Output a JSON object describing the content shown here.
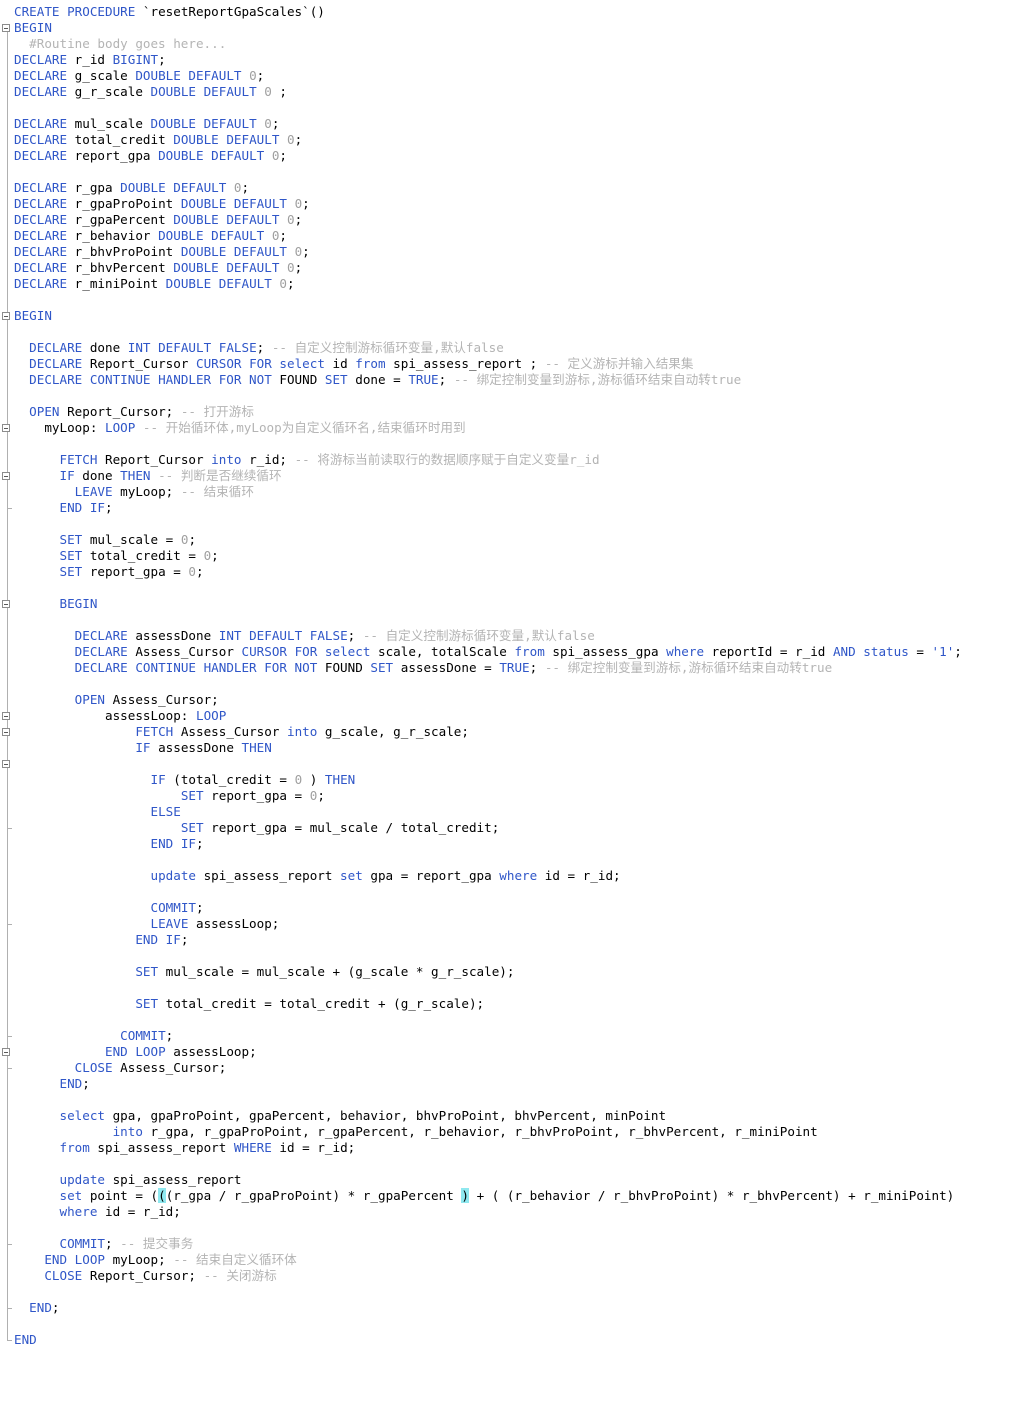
{
  "editor": {
    "lines": [
      [
        [
          "k",
          "CREATE PROCEDURE "
        ],
        [
          "t",
          "`resetReportGpaScales`()"
        ]
      ],
      [
        [
          "k",
          "BEGIN"
        ]
      ],
      [
        [
          "c",
          "  #Routine body goes here..."
        ]
      ],
      [
        [
          "k",
          "DECLARE "
        ],
        [
          "t",
          "r_id "
        ],
        [
          "k",
          "BIGINT"
        ],
        [
          "t",
          ";"
        ]
      ],
      [
        [
          "k",
          "DECLARE "
        ],
        [
          "t",
          "g_scale "
        ],
        [
          "k",
          "DOUBLE DEFAULT "
        ],
        [
          "n",
          "0"
        ],
        [
          "t",
          ";"
        ]
      ],
      [
        [
          "k",
          "DECLARE "
        ],
        [
          "t",
          "g_r_scale "
        ],
        [
          "k",
          "DOUBLE DEFAULT "
        ],
        [
          "n",
          "0"
        ],
        [
          "t",
          " ;"
        ]
      ],
      [],
      [
        [
          "k",
          "DECLARE "
        ],
        [
          "t",
          "mul_scale "
        ],
        [
          "k",
          "DOUBLE DEFAULT "
        ],
        [
          "n",
          "0"
        ],
        [
          "t",
          ";"
        ]
      ],
      [
        [
          "k",
          "DECLARE "
        ],
        [
          "t",
          "total_credit "
        ],
        [
          "k",
          "DOUBLE DEFAULT "
        ],
        [
          "n",
          "0"
        ],
        [
          "t",
          ";"
        ]
      ],
      [
        [
          "k",
          "DECLARE "
        ],
        [
          "t",
          "report_gpa "
        ],
        [
          "k",
          "DOUBLE DEFAULT "
        ],
        [
          "n",
          "0"
        ],
        [
          "t",
          ";"
        ]
      ],
      [],
      [
        [
          "k",
          "DECLARE "
        ],
        [
          "t",
          "r_gpa "
        ],
        [
          "k",
          "DOUBLE DEFAULT "
        ],
        [
          "n",
          "0"
        ],
        [
          "t",
          ";"
        ]
      ],
      [
        [
          "k",
          "DECLARE "
        ],
        [
          "t",
          "r_gpaProPoint "
        ],
        [
          "k",
          "DOUBLE DEFAULT "
        ],
        [
          "n",
          "0"
        ],
        [
          "t",
          ";"
        ]
      ],
      [
        [
          "k",
          "DECLARE "
        ],
        [
          "t",
          "r_gpaPercent "
        ],
        [
          "k",
          "DOUBLE DEFAULT "
        ],
        [
          "n",
          "0"
        ],
        [
          "t",
          ";"
        ]
      ],
      [
        [
          "k",
          "DECLARE "
        ],
        [
          "t",
          "r_behavior "
        ],
        [
          "k",
          "DOUBLE DEFAULT "
        ],
        [
          "n",
          "0"
        ],
        [
          "t",
          ";"
        ]
      ],
      [
        [
          "k",
          "DECLARE "
        ],
        [
          "t",
          "r_bhvProPoint "
        ],
        [
          "k",
          "DOUBLE DEFAULT "
        ],
        [
          "n",
          "0"
        ],
        [
          "t",
          ";"
        ]
      ],
      [
        [
          "k",
          "DECLARE "
        ],
        [
          "t",
          "r_bhvPercent "
        ],
        [
          "k",
          "DOUBLE DEFAULT "
        ],
        [
          "n",
          "0"
        ],
        [
          "t",
          ";"
        ]
      ],
      [
        [
          "k",
          "DECLARE "
        ],
        [
          "t",
          "r_miniPoint "
        ],
        [
          "k",
          "DOUBLE DEFAULT "
        ],
        [
          "n",
          "0"
        ],
        [
          "t",
          ";"
        ]
      ],
      [],
      [
        [
          "k",
          "BEGIN"
        ]
      ],
      [],
      [
        [
          "t",
          "  "
        ],
        [
          "k",
          "DECLARE "
        ],
        [
          "t",
          "done "
        ],
        [
          "k",
          "INT DEFAULT FALSE"
        ],
        [
          "t",
          "; "
        ],
        [
          "c",
          "-- 自定义控制游标循环变量,默认false"
        ]
      ],
      [
        [
          "t",
          "  "
        ],
        [
          "k",
          "DECLARE "
        ],
        [
          "t",
          "Report_Cursor "
        ],
        [
          "k",
          "CURSOR FOR select "
        ],
        [
          "t",
          "id "
        ],
        [
          "k",
          "from "
        ],
        [
          "t",
          "spi_assess_report ; "
        ],
        [
          "c",
          "-- 定义游标并输入结果集"
        ]
      ],
      [
        [
          "t",
          "  "
        ],
        [
          "k",
          "DECLARE CONTINUE HANDLER FOR NOT "
        ],
        [
          "t",
          "FOUND "
        ],
        [
          "k",
          "SET "
        ],
        [
          "t",
          "done = "
        ],
        [
          "k",
          "TRUE"
        ],
        [
          "t",
          "; "
        ],
        [
          "c",
          "-- 绑定控制变量到游标,游标循环结束自动转true"
        ]
      ],
      [],
      [
        [
          "t",
          "  "
        ],
        [
          "k",
          "OPEN "
        ],
        [
          "t",
          "Report_Cursor; "
        ],
        [
          "c",
          "-- 打开游标"
        ]
      ],
      [
        [
          "t",
          "    myLoop: "
        ],
        [
          "k",
          "LOOP "
        ],
        [
          "c",
          "-- 开始循环体,myLoop为自定义循环名,结束循环时用到"
        ]
      ],
      [],
      [
        [
          "t",
          "      "
        ],
        [
          "k",
          "FETCH "
        ],
        [
          "t",
          "Report_Cursor "
        ],
        [
          "k",
          "into "
        ],
        [
          "t",
          "r_id; "
        ],
        [
          "c",
          "-- 将游标当前读取行的数据顺序赋于自定义变量r_id"
        ]
      ],
      [
        [
          "t",
          "      "
        ],
        [
          "k",
          "IF "
        ],
        [
          "t",
          "done "
        ],
        [
          "k",
          "THEN "
        ],
        [
          "c",
          "-- 判断是否继续循环"
        ]
      ],
      [
        [
          "t",
          "        "
        ],
        [
          "k",
          "LEAVE "
        ],
        [
          "t",
          "myLoop; "
        ],
        [
          "c",
          "-- 结束循环"
        ]
      ],
      [
        [
          "t",
          "      "
        ],
        [
          "k",
          "END IF"
        ],
        [
          "t",
          ";"
        ]
      ],
      [],
      [
        [
          "t",
          "      "
        ],
        [
          "k",
          "SET "
        ],
        [
          "t",
          "mul_scale = "
        ],
        [
          "n",
          "0"
        ],
        [
          "t",
          ";"
        ]
      ],
      [
        [
          "t",
          "      "
        ],
        [
          "k",
          "SET "
        ],
        [
          "t",
          "total_credit = "
        ],
        [
          "n",
          "0"
        ],
        [
          "t",
          ";"
        ]
      ],
      [
        [
          "t",
          "      "
        ],
        [
          "k",
          "SET "
        ],
        [
          "t",
          "report_gpa = "
        ],
        [
          "n",
          "0"
        ],
        [
          "t",
          ";"
        ]
      ],
      [],
      [
        [
          "t",
          "      "
        ],
        [
          "k",
          "BEGIN"
        ]
      ],
      [],
      [
        [
          "t",
          "        "
        ],
        [
          "k",
          "DECLARE "
        ],
        [
          "t",
          "assessDone "
        ],
        [
          "k",
          "INT DEFAULT FALSE"
        ],
        [
          "t",
          "; "
        ],
        [
          "c",
          "-- 自定义控制游标循环变量,默认false"
        ]
      ],
      [
        [
          "t",
          "        "
        ],
        [
          "k",
          "DECLARE "
        ],
        [
          "t",
          "Assess_Cursor "
        ],
        [
          "k",
          "CURSOR FOR select "
        ],
        [
          "t",
          "scale, totalScale "
        ],
        [
          "k",
          "from "
        ],
        [
          "t",
          "spi_assess_gpa "
        ],
        [
          "k",
          "where "
        ],
        [
          "t",
          "reportId = r_id "
        ],
        [
          "k",
          "AND status "
        ],
        [
          "t",
          "= "
        ],
        [
          "s",
          "'1'"
        ],
        [
          "t",
          ";"
        ]
      ],
      [
        [
          "t",
          "        "
        ],
        [
          "k",
          "DECLARE CONTINUE HANDLER FOR NOT "
        ],
        [
          "t",
          "FOUND "
        ],
        [
          "k",
          "SET "
        ],
        [
          "t",
          "assessDone = "
        ],
        [
          "k",
          "TRUE"
        ],
        [
          "t",
          "; "
        ],
        [
          "c",
          "-- 绑定控制变量到游标,游标循环结束自动转true"
        ]
      ],
      [],
      [
        [
          "t",
          "        "
        ],
        [
          "k",
          "OPEN "
        ],
        [
          "t",
          "Assess_Cursor;"
        ]
      ],
      [
        [
          "t",
          "            assessLoop: "
        ],
        [
          "k",
          "LOOP"
        ]
      ],
      [
        [
          "t",
          "                "
        ],
        [
          "k",
          "FETCH "
        ],
        [
          "t",
          "Assess_Cursor "
        ],
        [
          "k",
          "into "
        ],
        [
          "t",
          "g_scale, g_r_scale;"
        ]
      ],
      [
        [
          "t",
          "                "
        ],
        [
          "k",
          "IF "
        ],
        [
          "t",
          "assessDone "
        ],
        [
          "k",
          "THEN"
        ]
      ],
      [],
      [
        [
          "t",
          "                  "
        ],
        [
          "k",
          "IF "
        ],
        [
          "t",
          "(total_credit = "
        ],
        [
          "n",
          "0"
        ],
        [
          "t",
          " ) "
        ],
        [
          "k",
          "THEN"
        ]
      ],
      [
        [
          "t",
          "                      "
        ],
        [
          "k",
          "SET "
        ],
        [
          "t",
          "report_gpa = "
        ],
        [
          "n",
          "0"
        ],
        [
          "t",
          ";"
        ]
      ],
      [
        [
          "t",
          "                  "
        ],
        [
          "k",
          "ELSE"
        ]
      ],
      [
        [
          "t",
          "                      "
        ],
        [
          "k",
          "SET "
        ],
        [
          "t",
          "report_gpa = mul_scale / total_credit;"
        ]
      ],
      [
        [
          "t",
          "                  "
        ],
        [
          "k",
          "END IF"
        ],
        [
          "t",
          ";"
        ]
      ],
      [],
      [
        [
          "t",
          "                  "
        ],
        [
          "k",
          "update "
        ],
        [
          "t",
          "spi_assess_report "
        ],
        [
          "k",
          "set "
        ],
        [
          "t",
          "gpa = report_gpa "
        ],
        [
          "k",
          "where "
        ],
        [
          "t",
          "id = r_id;"
        ]
      ],
      [],
      [
        [
          "t",
          "                  "
        ],
        [
          "k",
          "COMMIT"
        ],
        [
          "t",
          ";"
        ]
      ],
      [
        [
          "t",
          "                  "
        ],
        [
          "k",
          "LEAVE "
        ],
        [
          "t",
          "assessLoop;"
        ]
      ],
      [
        [
          "t",
          "                "
        ],
        [
          "k",
          "END IF"
        ],
        [
          "t",
          ";"
        ]
      ],
      [],
      [
        [
          "t",
          "                "
        ],
        [
          "k",
          "SET "
        ],
        [
          "t",
          "mul_scale = mul_scale + (g_scale * g_r_scale);"
        ]
      ],
      [],
      [
        [
          "t",
          "                "
        ],
        [
          "k",
          "SET "
        ],
        [
          "t",
          "total_credit = total_credit + (g_r_scale);"
        ]
      ],
      [],
      [
        [
          "t",
          "              "
        ],
        [
          "k",
          "COMMIT"
        ],
        [
          "t",
          ";"
        ]
      ],
      [
        [
          "t",
          "            "
        ],
        [
          "k",
          "END LOOP "
        ],
        [
          "t",
          "assessLoop;"
        ]
      ],
      [
        [
          "t",
          "        "
        ],
        [
          "k",
          "CLOSE "
        ],
        [
          "t",
          "Assess_Cursor;"
        ]
      ],
      [
        [
          "t",
          "      "
        ],
        [
          "k",
          "END"
        ],
        [
          "t",
          ";"
        ]
      ],
      [],
      [
        [
          "t",
          "      "
        ],
        [
          "k",
          "select "
        ],
        [
          "t",
          "gpa, gpaProPoint, gpaPercent, behavior, bhvProPoint, bhvPercent, minPoint"
        ]
      ],
      [
        [
          "t",
          "             "
        ],
        [
          "k",
          "into "
        ],
        [
          "t",
          "r_gpa, r_gpaProPoint, r_gpaPercent, r_behavior, r_bhvProPoint, r_bhvPercent, r_miniPoint"
        ]
      ],
      [
        [
          "t",
          "      "
        ],
        [
          "k",
          "from "
        ],
        [
          "t",
          "spi_assess_report "
        ],
        [
          "k",
          "WHERE "
        ],
        [
          "t",
          "id = r_id;"
        ]
      ],
      [],
      [
        [
          "t",
          "      "
        ],
        [
          "k",
          "update "
        ],
        [
          "t",
          "spi_assess_report"
        ]
      ],
      [
        [
          "t",
          "      "
        ],
        [
          "k",
          "set "
        ],
        [
          "t",
          "point = ("
        ],
        [
          "b",
          "("
        ],
        [
          "t",
          "(r_gpa / r_gpaProPoint) * r_gpaPercent "
        ],
        [
          "b",
          ")"
        ],
        [
          "t",
          " + ( (r_behavior / r_bhvProPoint) * r_bhvPercent) + r_miniPoint)"
        ]
      ],
      [
        [
          "t",
          "      "
        ],
        [
          "k",
          "where "
        ],
        [
          "t",
          "id = r_id;"
        ]
      ],
      [],
      [
        [
          "t",
          "      "
        ],
        [
          "k",
          "COMMIT"
        ],
        [
          "t",
          "; "
        ],
        [
          "c",
          "-- 提交事务"
        ]
      ],
      [
        [
          "t",
          "    "
        ],
        [
          "k",
          "END LOOP "
        ],
        [
          "t",
          "myLoop; "
        ],
        [
          "c",
          "-- 结束自定义循环体"
        ]
      ],
      [
        [
          "t",
          "    "
        ],
        [
          "k",
          "CLOSE "
        ],
        [
          "t",
          "Report_Cursor; "
        ],
        [
          "c",
          "-- 关闭游标"
        ]
      ],
      [],
      [
        [
          "t",
          "  "
        ],
        [
          "k",
          "END"
        ],
        [
          "t",
          ";"
        ]
      ],
      [],
      [
        [
          "k",
          "END"
        ]
      ]
    ]
  }
}
